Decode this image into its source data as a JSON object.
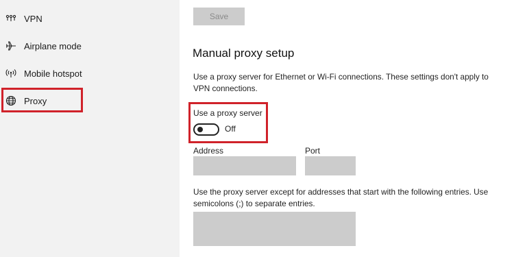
{
  "sidebar": {
    "items": [
      {
        "label": "VPN",
        "icon": "vpn-icon"
      },
      {
        "label": "Airplane mode",
        "icon": "airplane-icon"
      },
      {
        "label": "Mobile hotspot",
        "icon": "hotspot-icon"
      },
      {
        "label": "Proxy",
        "icon": "globe-icon",
        "selected": true
      }
    ]
  },
  "main": {
    "save_label": "Save",
    "section_title": "Manual proxy setup",
    "description": "Use a proxy server for Ethernet or Wi-Fi connections. These settings don't apply to VPN connections.",
    "use_proxy_label": "Use a proxy server",
    "toggle_state": "Off",
    "address_label": "Address",
    "port_label": "Port",
    "address_value": "",
    "port_value": "",
    "exceptions_description": "Use the proxy server except for addresses that start with the following entries. Use semicolons (;) to separate entries.",
    "exceptions_value": ""
  },
  "colors": {
    "highlight": "#d0222a",
    "sidebar_bg": "#f2f2f2",
    "disabled_field": "#cccccc"
  }
}
